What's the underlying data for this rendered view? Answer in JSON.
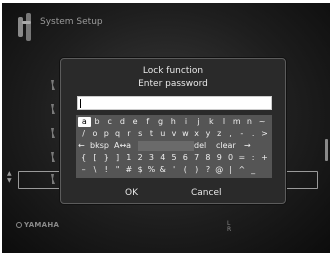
{
  "header": {
    "title": "System Setup",
    "icon": "setup-tools-icon"
  },
  "dialog": {
    "title": "Lock function",
    "subtitle": "Enter password",
    "password_value": "",
    "ok_label": "OK",
    "cancel_label": "Cancel"
  },
  "keyboard": {
    "rows": [
      [
        {
          "label": "a",
          "selected": true
        },
        {
          "label": "b"
        },
        {
          "label": "c"
        },
        {
          "label": "d"
        },
        {
          "label": "e"
        },
        {
          "label": "f"
        },
        {
          "label": "g"
        },
        {
          "label": "h"
        },
        {
          "label": "i"
        },
        {
          "label": "j"
        },
        {
          "label": "k"
        },
        {
          "label": "l"
        },
        {
          "label": "m"
        },
        {
          "label": "n"
        },
        {
          "label": "~"
        }
      ],
      [
        {
          "label": "/"
        },
        {
          "label": "o"
        },
        {
          "label": "p"
        },
        {
          "label": "q"
        },
        {
          "label": "r"
        },
        {
          "label": "s"
        },
        {
          "label": "t"
        },
        {
          "label": "u"
        },
        {
          "label": "v"
        },
        {
          "label": "w"
        },
        {
          "label": "x"
        },
        {
          "label": "y"
        },
        {
          "label": "z"
        },
        {
          "label": ","
        },
        {
          "label": "-"
        },
        {
          "label": "."
        },
        {
          "label": ">"
        }
      ],
      [
        {
          "label": "←"
        },
        {
          "label": "bksp"
        },
        {
          "label": "A↔a"
        },
        {
          "label": "",
          "space": true
        },
        {
          "label": "del"
        },
        {
          "label": "clear"
        },
        {
          "label": "→"
        }
      ],
      [
        {
          "label": "{"
        },
        {
          "label": "["
        },
        {
          "label": "}"
        },
        {
          "label": "]"
        },
        {
          "label": "1"
        },
        {
          "label": "2"
        },
        {
          "label": "3"
        },
        {
          "label": "4"
        },
        {
          "label": "5"
        },
        {
          "label": "6"
        },
        {
          "label": "7"
        },
        {
          "label": "8"
        },
        {
          "label": "9"
        },
        {
          "label": "0"
        },
        {
          "label": "="
        },
        {
          "label": ":"
        },
        {
          "label": "+"
        }
      ],
      [
        {
          "label": "–"
        },
        {
          "label": "\\"
        },
        {
          "label": "!"
        },
        {
          "label": "\""
        },
        {
          "label": "#"
        },
        {
          "label": "$"
        },
        {
          "label": "%"
        },
        {
          "label": "&"
        },
        {
          "label": "'"
        },
        {
          "label": "("
        },
        {
          "label": ")"
        },
        {
          "label": "?"
        },
        {
          "label": "@"
        },
        {
          "label": "|"
        },
        {
          "label": "^"
        },
        {
          "label": "_"
        }
      ]
    ]
  },
  "footer": {
    "brand": "YAMAHA",
    "channel_icon": "left-right-channel-icon",
    "channel_letters": [
      "L",
      "R"
    ]
  },
  "colors": {
    "screen_bg": "#1e1e1e",
    "dialog_bg": "#2a2a2a",
    "keyboard_bg": "#555555",
    "text": "#e8e8e8",
    "dim_text": "#9a9a9a"
  }
}
